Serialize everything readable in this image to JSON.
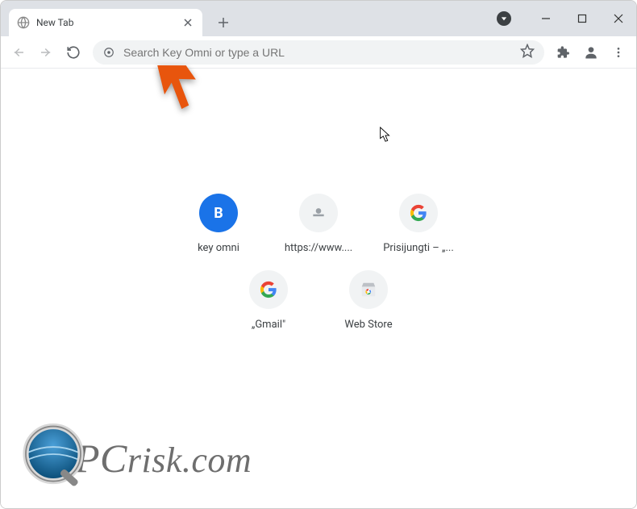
{
  "tab": {
    "title": "New Tab"
  },
  "omnibox": {
    "placeholder": "Search Key Omni or type a URL"
  },
  "shortcuts": {
    "row1": [
      {
        "label": "key omni"
      },
      {
        "label": "https://www...."
      },
      {
        "label": "Prisijungti – „..."
      }
    ],
    "row2": [
      {
        "label": "„Gmail\""
      },
      {
        "label": "Web Store"
      }
    ]
  },
  "watermark": {
    "text_p": "P",
    "text_c": "C",
    "text_rest": "risk.com"
  }
}
